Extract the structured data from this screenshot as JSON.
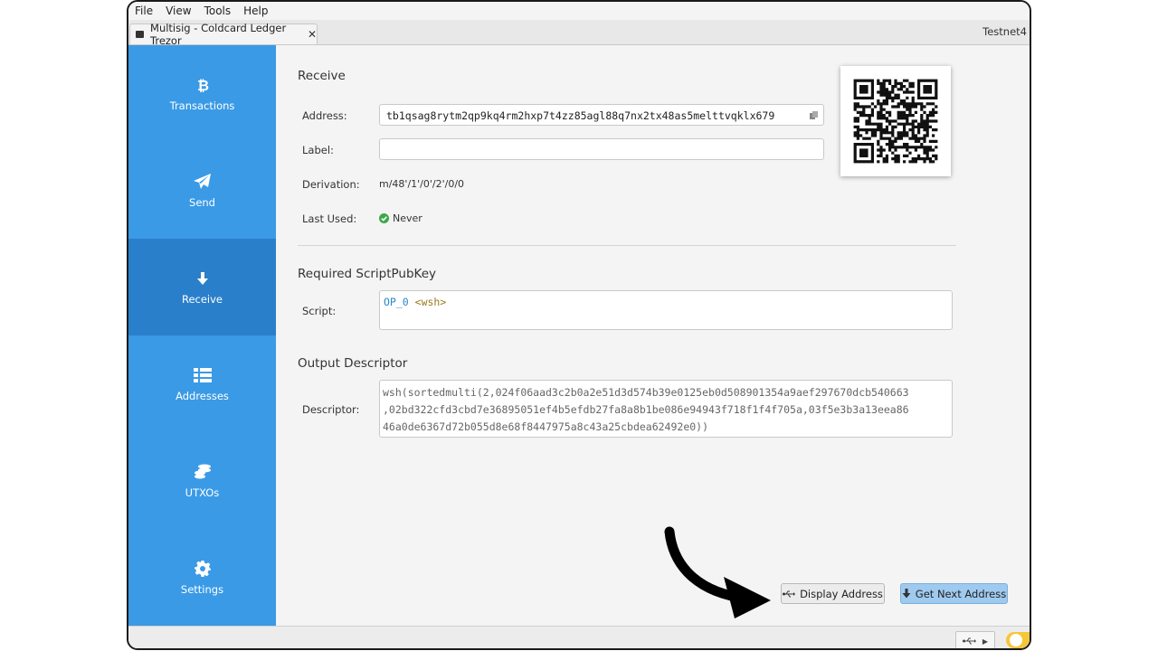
{
  "menu": [
    "File",
    "View",
    "Tools",
    "Help"
  ],
  "tab": {
    "title": "Multisig - Coldcard Ledger Trezor",
    "close": "✕"
  },
  "network": "Testnet4",
  "sidebar": {
    "items": [
      {
        "label": "Transactions",
        "icon": "bitcoin-icon"
      },
      {
        "label": "Send",
        "icon": "paper-plane-icon"
      },
      {
        "label": "Receive",
        "icon": "arrow-down-icon"
      },
      {
        "label": "Addresses",
        "icon": "list-icon"
      },
      {
        "label": "UTXOs",
        "icon": "coins-icon"
      },
      {
        "label": "Settings",
        "icon": "gear-icon"
      }
    ],
    "active": "Receive",
    "color": "#3a9ae6",
    "active_color": "#2a7fcb"
  },
  "receive": {
    "title": "Receive",
    "address_label": "Address:",
    "address": "tb1qsag8rytm2qp9kq4rm2hxp7t4zz85agl88q7nx2tx48as5melttvqklx679",
    "label_label": "Label:",
    "label_value": "",
    "derivation_label": "Derivation:",
    "derivation": "m/48'/1'/0'/2'/0/0",
    "last_used_label": "Last Used:",
    "last_used": "Never"
  },
  "script_section": {
    "title": "Required ScriptPubKey",
    "script_label": "Script:",
    "opcode": "OP_0",
    "arg": "<wsh>"
  },
  "descriptor_section": {
    "title": "Output Descriptor",
    "descriptor_label": "Descriptor:",
    "lines": [
      "wsh(sortedmulti(2,024f06aad3c2b0a2e51d3d574b39e0125eb0d508901354a9aef297670dcb540663",
      ",02bd322cfd3cbd7e36895051ef4b5efdb27fa8a8b1be086e94943f718f1f4f705a,03f5e3b3a13eea86",
      "46a0de6367d72b055d8e68f8447975a8c43a25cbdea62492e0))"
    ]
  },
  "buttons": {
    "display_address": "Display Address",
    "get_next_address": "Get Next Address"
  }
}
